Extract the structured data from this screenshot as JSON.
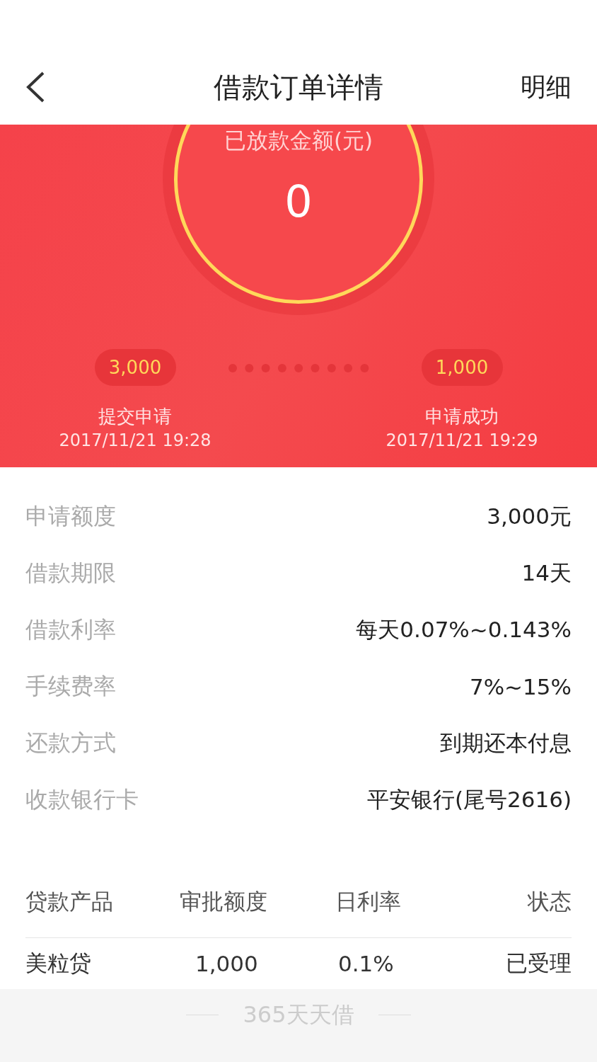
{
  "header": {
    "title": "借款订单详情",
    "action": "明细"
  },
  "banner": {
    "amount_label": "已放款金额(元)",
    "amount": "0",
    "steps": [
      {
        "value": "3,000",
        "label": "提交申请",
        "time": "2017/11/21 19:28"
      },
      {
        "value": "1,000",
        "label": "申请成功",
        "time": "2017/11/21 19:29"
      }
    ]
  },
  "details": [
    {
      "label": "申请额度",
      "value": "3,000元"
    },
    {
      "label": "借款期限",
      "value": "14天"
    },
    {
      "label": "借款利率",
      "value": "每天0.07%~0.143%"
    },
    {
      "label": "手续费率",
      "value": "7%~15%"
    },
    {
      "label": "还款方式",
      "value": "到期还本付息"
    },
    {
      "label": "收款银行卡",
      "value": "平安银行(尾号2616)"
    }
  ],
  "table": {
    "columns": [
      "贷款产品",
      "审批额度",
      "日利率",
      "状态"
    ],
    "rows": [
      [
        "美粒贷",
        "1,000",
        "0.1%",
        "已受理"
      ]
    ]
  },
  "footer": {
    "text": "365天天借"
  }
}
